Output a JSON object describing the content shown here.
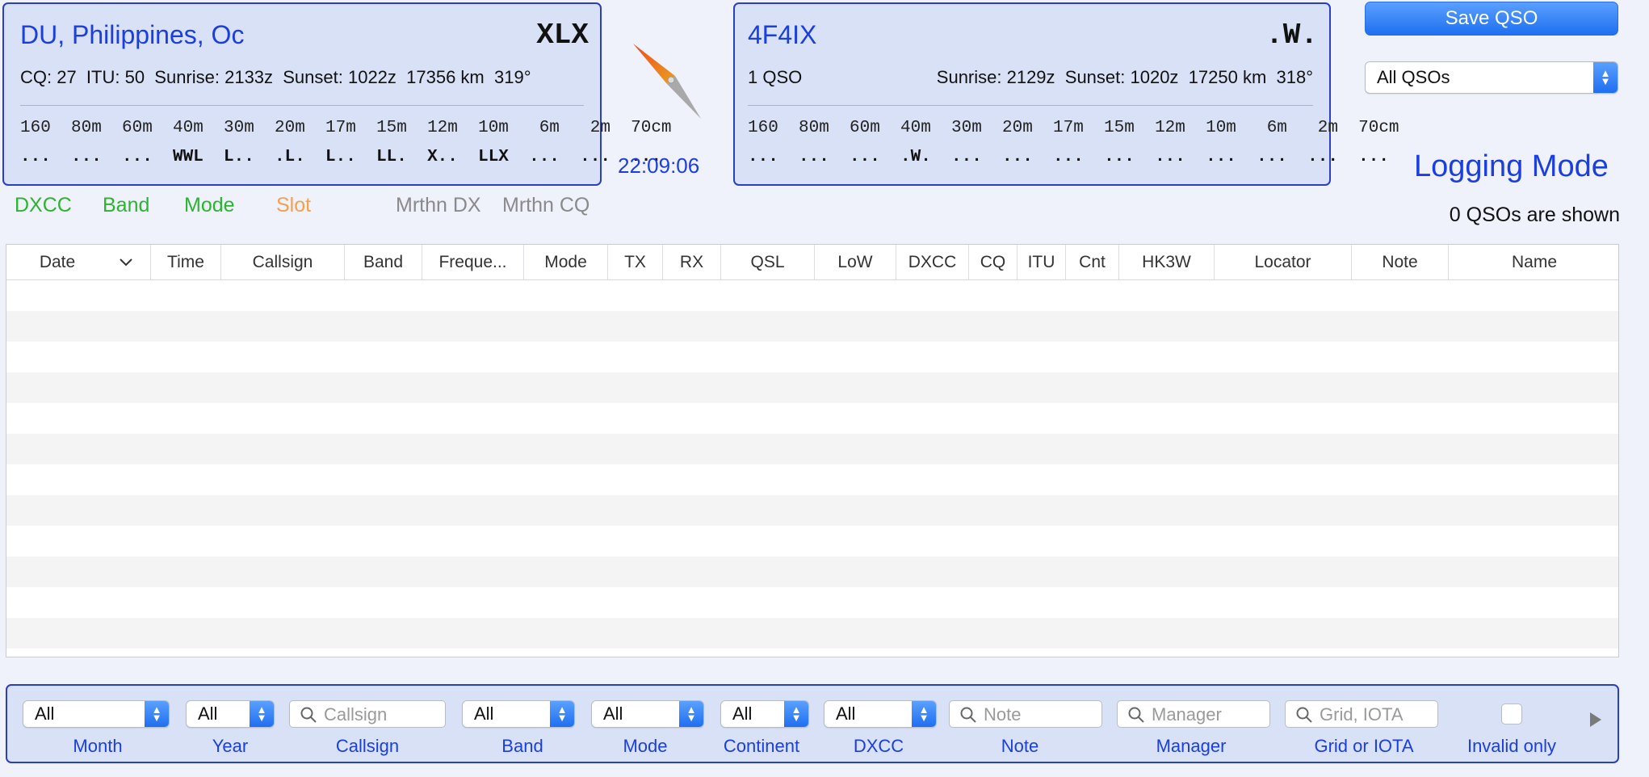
{
  "dx_panel": {
    "title": "DU, Philippines, Oc",
    "status": "XLX",
    "info": "CQ: 27  ITU: 50  Sunrise: 2133z  Sunset: 1022z  17356 km  319°",
    "bands": "160  80m  60m  40m  30m  20m  17m  15m  12m  10m   6m   2m  70cm",
    "band_status": "...  ...  ...  WWL  L..  .L.  L..  LL.  X..  LLX  ...  ...  ..."
  },
  "clock": "22:09:06",
  "call_panel": {
    "title": "4F4IX",
    "status": ".W.",
    "qso_count": "1 QSO",
    "info": "Sunrise: 2129z  Sunset: 1020z  17250 km  318°",
    "bands": "160  80m  60m  40m  30m  20m  17m  15m  12m  10m   6m   2m  70cm",
    "band_status": "...  ...  ...  .W.  ...  ...  ...  ...  ...  ...  ...  ...  ..."
  },
  "tabs": [
    {
      "label": "DXCC",
      "color": "#2bb52f"
    },
    {
      "label": "Band",
      "color": "#2bb52f"
    },
    {
      "label": "Mode",
      "color": "#2bb52f"
    },
    {
      "label": "Slot",
      "color": "#f5a04a"
    },
    {
      "label": "Mrthn DX",
      "color": "#8a8a8a"
    },
    {
      "label": "Mrthn CQ",
      "color": "#8a8a8a"
    }
  ],
  "save_button": "Save QSO",
  "qso_filter": "All QSOs",
  "mode_title": "Logging Mode",
  "shown_count": "0 QSOs are shown",
  "table": {
    "columns": [
      "Date",
      "Time",
      "Callsign",
      "Band",
      "Freque...",
      "Mode",
      "TX",
      "RX",
      "QSL",
      "LoW",
      "DXCC",
      "CQ",
      "ITU",
      "Cnt",
      "HK3W",
      "Locator",
      "Note",
      "Name"
    ],
    "rows": []
  },
  "filters": {
    "month": {
      "value": "All",
      "label": "Month"
    },
    "year": {
      "value": "All",
      "label": "Year"
    },
    "callsign": {
      "placeholder": "Callsign",
      "label": "Callsign"
    },
    "band": {
      "value": "All",
      "label": "Band"
    },
    "mode": {
      "value": "All",
      "label": "Mode"
    },
    "continent": {
      "value": "All",
      "label": "Continent"
    },
    "dxcc": {
      "value": "All",
      "label": "DXCC"
    },
    "note": {
      "placeholder": "Note",
      "label": "Note"
    },
    "manager": {
      "placeholder": "Manager",
      "label": "Manager"
    },
    "grid": {
      "placeholder": "Grid, IOTA",
      "label": "Grid or IOTA"
    },
    "invalid": {
      "checked": false,
      "label": "Invalid only"
    }
  },
  "colors": {
    "accent": "#1a3ee0",
    "panel_bg": "#d9e1f7",
    "panel_border": "#2a3fc4"
  }
}
